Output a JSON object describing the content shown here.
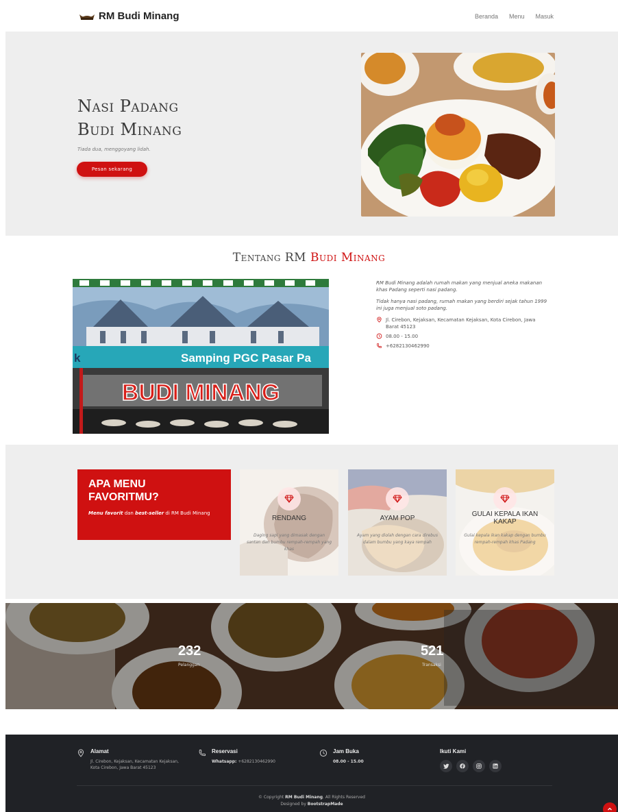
{
  "header": {
    "brand": "RM Budi Minang",
    "nav": [
      "Beranda",
      "Menu",
      "Masuk"
    ]
  },
  "hero": {
    "title_line1": "Nasi Padang",
    "title_line2": "Budi Minang",
    "subtitle": "Tiada dua, menggoyang lidah.",
    "cta": "Pesan sekarang"
  },
  "about": {
    "title_plain": "Tentang RM ",
    "title_accent": "Budi Minang",
    "sign_line": "Samping PGC Pasar Pa",
    "sign_name": "BUDI MINANG",
    "sign_k": "k",
    "para1": "RM Budi Minang adalah rumah makan yang menjual aneka makanan khas Padang seperti nasi padang.",
    "para2": "Tidak hanya nasi padang, rumah makan yang berdiri sejak tahun 1999 ini juga menjual soto padang.",
    "address": "Jl. Cirebon, Kejaksan, Kecamatan Kejaksan, Kota Cirebon, Jawa Barat 45123",
    "hours": "08.00 - 15.00",
    "phone": "+6282130462990"
  },
  "favorites": {
    "heading_line1": "APA MENU",
    "heading_line2": "FAVORITMU?",
    "sub_b1": "Menu favorit",
    "sub_mid": " dan ",
    "sub_b2": "best-seller",
    "sub_end": " di RM Budi Minang",
    "items": [
      {
        "name": "RENDANG",
        "desc": "Daging sapi yang dimasak dengan santan dan bumbu rempah-rempah yang khas"
      },
      {
        "name": "AYAM POP",
        "desc": "Ayam yang diolah dengan cara direbus dalam bumbu yang kaya rempah"
      },
      {
        "name": "GULAI KEPALA IKAN KAKAP",
        "desc": "Gulai kepala ikan kakap dengan bumbu rempah-rempah khas Padang"
      }
    ]
  },
  "stats": [
    {
      "value": "232",
      "label": "Pelanggan"
    },
    {
      "value": "521",
      "label": "Transaksi"
    }
  ],
  "footer": {
    "address_title": "Alamat",
    "address_text": "Jl. Cirebon, Kejaksan, Kecamatan Kejaksan, Kota Cirebon, Jawa Barat 45123",
    "reservation_title": "Reservasi",
    "reservation_label": "Whatsapp:",
    "reservation_value": " +6282130462990",
    "hours_title": "Jam Buka",
    "hours_text": "08.00 - 15.00",
    "social_title": "Ikuti Kami",
    "copyright_pre": "© Copyright ",
    "copyright_brand": "RM Budi Minang",
    "copyright_post": ". All Rights Reserved",
    "designed_pre": "Designed by ",
    "designed_brand": "BootstrapMade"
  },
  "colors": {
    "accent": "#cf1111",
    "light_bg": "#eeeeee",
    "footer_bg": "#202226"
  },
  "icons": [
    "map-pin-icon",
    "clock-icon",
    "phone-icon",
    "diamond-icon",
    "twitter-icon",
    "facebook-icon",
    "instagram-icon",
    "linkedin-icon",
    "arrow-up-icon"
  ]
}
